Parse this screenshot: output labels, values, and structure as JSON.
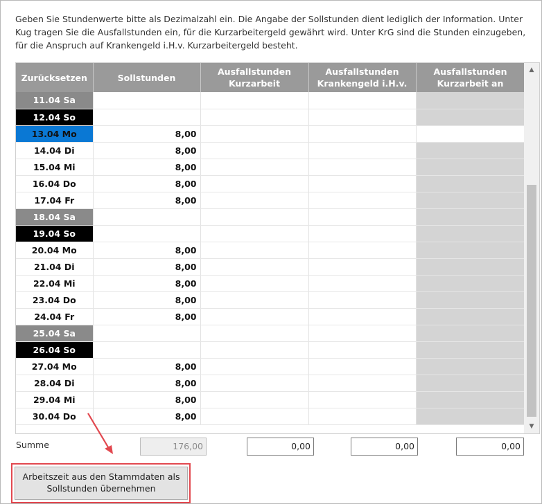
{
  "info_text": "Geben Sie Stundenwerte bitte als Dezimalzahl ein. Die Angabe der Sollstunden dient lediglich der Information. Unter Kug tragen Sie die Ausfallstunden ein, für die Kurzarbeitergeld gewährt wird. Unter KrG sind die Stunden einzugeben, für die Anspruch auf Krankengeld i.H.v. Kurzarbeitergeld besteht.",
  "table": {
    "headers": [
      "Zurücksetzen",
      "Sollstunden",
      "Ausfallstunden Kurzarbeit",
      "Ausfallstunden Krankengeld i.H.v.",
      "Ausfallstunden Kurzarbeit an"
    ],
    "rows": [
      {
        "date": "11.04 Sa",
        "kind": "sa",
        "soll": ""
      },
      {
        "date": "12.04 So",
        "kind": "so",
        "soll": ""
      },
      {
        "date": "13.04 Mo",
        "kind": "sel",
        "soll": "8,00"
      },
      {
        "date": "14.04 Di",
        "kind": "day",
        "soll": "8,00"
      },
      {
        "date": "15.04 Mi",
        "kind": "day",
        "soll": "8,00"
      },
      {
        "date": "16.04 Do",
        "kind": "day",
        "soll": "8,00"
      },
      {
        "date": "17.04 Fr",
        "kind": "day",
        "soll": "8,00"
      },
      {
        "date": "18.04 Sa",
        "kind": "sa",
        "soll": ""
      },
      {
        "date": "19.04 So",
        "kind": "so",
        "soll": ""
      },
      {
        "date": "20.04 Mo",
        "kind": "day",
        "soll": "8,00"
      },
      {
        "date": "21.04 Di",
        "kind": "day",
        "soll": "8,00"
      },
      {
        "date": "22.04 Mi",
        "kind": "day",
        "soll": "8,00"
      },
      {
        "date": "23.04 Do",
        "kind": "day",
        "soll": "8,00"
      },
      {
        "date": "24.04 Fr",
        "kind": "day",
        "soll": "8,00"
      },
      {
        "date": "25.04 Sa",
        "kind": "sa",
        "soll": ""
      },
      {
        "date": "26.04 So",
        "kind": "so",
        "soll": ""
      },
      {
        "date": "27.04 Mo",
        "kind": "day",
        "soll": "8,00"
      },
      {
        "date": "28.04 Di",
        "kind": "day",
        "soll": "8,00"
      },
      {
        "date": "29.04 Mi",
        "kind": "day",
        "soll": "8,00"
      },
      {
        "date": "30.04 Do",
        "kind": "day",
        "soll": "8,00"
      }
    ]
  },
  "summe": {
    "label": "Summe",
    "sollstunden": "176,00",
    "kurzarbeit": "0,00",
    "krankengeld": "0,00",
    "kurzarbeit_an": "0,00"
  },
  "button": {
    "label": "Arbeitszeit aus den Stammdaten als Sollstunden übernehmen"
  },
  "colors": {
    "header_bg": "#9a9a9a",
    "saturday_bg": "#8a8a8a",
    "sunday_bg": "#000000",
    "selected_bg": "#0a78d4",
    "disabled_cell_bg": "#d4d4d4",
    "highlight": "#e2484f"
  }
}
